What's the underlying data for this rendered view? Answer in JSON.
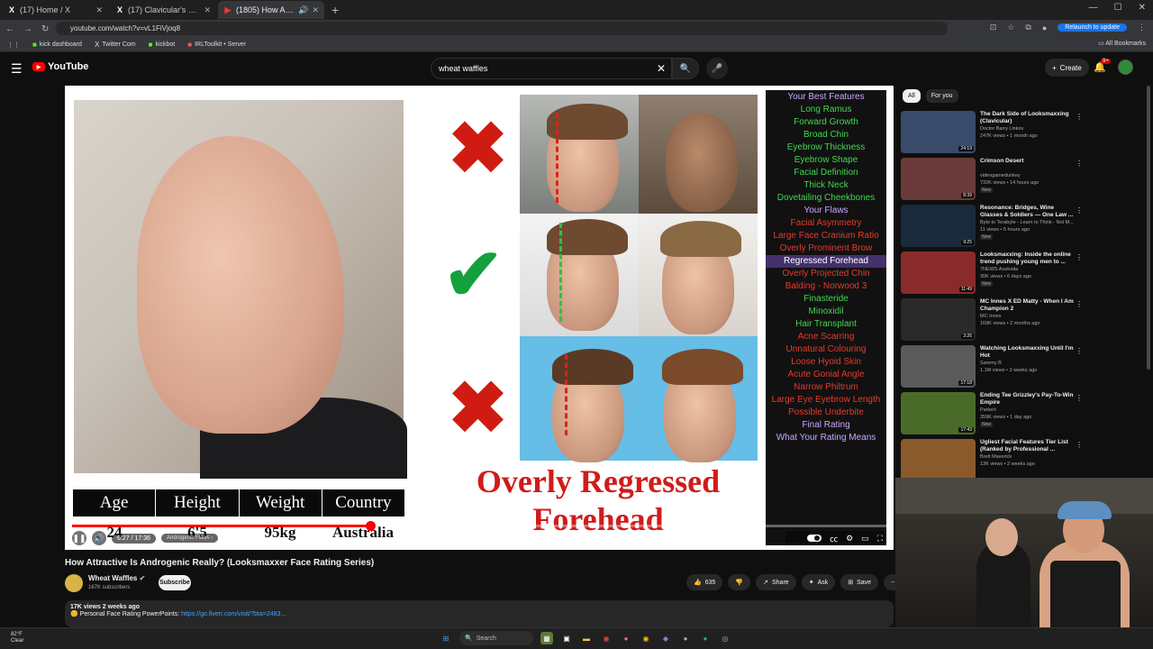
{
  "browser": {
    "tabs": [
      {
        "label": "(17) Home / X",
        "icon": "x-icon",
        "active": false
      },
      {
        "label": "(17) Clavicular's Clan Communi...",
        "icon": "x-icon",
        "active": false
      },
      {
        "label": "(1805) How Attractive Is An...",
        "icon": "youtube-icon",
        "active": true
      }
    ],
    "url": "youtube.com/watch?v=vL1FiVjoq8",
    "relaunch_label": "Relaunch to update",
    "bookmarks": [
      {
        "label": "kick dashboard",
        "icon": "kick-icon"
      },
      {
        "label": "Twitter Com",
        "icon": "x-icon"
      },
      {
        "label": "kickbot",
        "icon": "kick-icon"
      },
      {
        "label": "IRLToolkit • Server",
        "icon": "irl-icon"
      }
    ],
    "all_bookmarks": "All Bookmarks"
  },
  "header": {
    "logo": "YouTube",
    "search_value": "wheat waffles",
    "create_label": "Create",
    "notif_count": "9+"
  },
  "video": {
    "stats_headers": [
      "Age",
      "Height",
      "Weight",
      "Country"
    ],
    "stats_values": [
      "24",
      "6'5",
      "95kg",
      "Australia"
    ],
    "caption_line1": "Overly Regressed",
    "caption_line2": "Forehead",
    "features": [
      {
        "label": "Your Best Features",
        "kind": "head"
      },
      {
        "label": "Long Ramus",
        "kind": "good"
      },
      {
        "label": "Forward Growth",
        "kind": "good"
      },
      {
        "label": "Broad Chin",
        "kind": "good"
      },
      {
        "label": "Eyebrow Thickness",
        "kind": "good"
      },
      {
        "label": "Eyebrow Shape",
        "kind": "good"
      },
      {
        "label": "Facial Definition",
        "kind": "good"
      },
      {
        "label": "Thick Neck",
        "kind": "good"
      },
      {
        "label": "Dovetailing Cheekbones",
        "kind": "good"
      },
      {
        "label": "Your Flaws",
        "kind": "head"
      },
      {
        "label": "Facial Asymmetry",
        "kind": "bad"
      },
      {
        "label": "Large Face Cranium Ratio",
        "kind": "bad"
      },
      {
        "label": "Overly Prominent Brow",
        "kind": "bad"
      },
      {
        "label": "Regressed Forehead",
        "kind": "hl"
      },
      {
        "label": "Overly Projected Chin",
        "kind": "bad"
      },
      {
        "label": "Balding - Norwood 3",
        "kind": "bad"
      },
      {
        "label": "Finasteride",
        "kind": "good"
      },
      {
        "label": "Minoxidil",
        "kind": "good"
      },
      {
        "label": "Hair Transplant",
        "kind": "good"
      },
      {
        "label": "Acne Scarring",
        "kind": "bad"
      },
      {
        "label": "Unnatural Colouring",
        "kind": "bad"
      },
      {
        "label": "Loose Hyoid Skin",
        "kind": "bad"
      },
      {
        "label": "Acute Gonial Angle",
        "kind": "bad"
      },
      {
        "label": "Narrow Philtrum",
        "kind": "bad"
      },
      {
        "label": "Large Eye Eyebrow Length",
        "kind": "bad"
      },
      {
        "label": "Possible Underbite",
        "kind": "bad"
      },
      {
        "label": "Final Rating",
        "kind": "head"
      },
      {
        "label": "What Your Rating Means",
        "kind": "purple"
      }
    ],
    "time": "6:27 / 17:36",
    "chapter": "Androgenic Flaws",
    "progress": 0.366,
    "title": "How Attractive Is Androgenic Really? (Looksmaxxer Face Rating Series)"
  },
  "channel": {
    "name": "Wheat Waffles",
    "subs": "167K subscribers",
    "subscribe_label": "Subscribe"
  },
  "actions": {
    "likes": "635",
    "share": "Share",
    "ask": "Ask",
    "save": "Save"
  },
  "description": {
    "meta": "17K views  2 weeks ago",
    "line": "Personal Face Rating PowerPoints: ",
    "link": "https://go.fiverr.com/visit/?bta=2483..."
  },
  "sidebar": {
    "chips": [
      "All",
      "For you"
    ],
    "recs": [
      {
        "title": "The Dark Side of Looksmaxxing (Clavicular)",
        "channel": "Doctor Barry Linkov",
        "meta": "247K views • 1 month ago",
        "dur": "24:19",
        "new": "",
        "color": "#3a4a6a"
      },
      {
        "title": "Crimson Desert",
        "channel": "videogamedunkey",
        "meta": "732K views • 14 hours ago",
        "dur": "8:39",
        "new": "New",
        "color": "#6a3a3a"
      },
      {
        "title": "Resonance: Bridges, Wine Glasses & Soldiers — One Law ...",
        "channel": "Byte to Terabyte - Learn to Think - Not M...",
        "meta": "11 views • 5 hours ago",
        "dur": "9:25",
        "new": "New",
        "color": "#1b2a3a"
      },
      {
        "title": "Looksmaxxing: Inside the online trend pushing young men to ...",
        "channel": "7NEWS Australia",
        "meta": "30K views • 6 days ago",
        "dur": "11:49",
        "new": "New",
        "color": "#8a2b2b"
      },
      {
        "title": "MC Innes X ED Matty - When I Am Champion 2",
        "channel": "MC Innes",
        "meta": "169K views • 2 months ago",
        "dur": "3:26",
        "new": "",
        "color": "#2a2a2a"
      },
      {
        "title": "Watching Looksmaxxing Until I'm Hot",
        "channel": "Sammy B",
        "meta": "1.1M views • 3 weeks ago",
        "dur": "17:18",
        "new": "",
        "color": "#5a5a5a"
      },
      {
        "title": "Ending Tee Grizzley's Pay-To-Win Empire",
        "channel": "Parkert",
        "meta": "359K views • 1 day ago",
        "dur": "17:43",
        "new": "New",
        "color": "#4a6a2a"
      },
      {
        "title": "Ugliest Facial Features Tier List (Ranked by Professional ...",
        "channel": "Brett Maverick",
        "meta": "13K views • 2 weeks ago",
        "dur": "",
        "new": "",
        "color": "#8a5a2a"
      }
    ]
  },
  "taskbar": {
    "weather_temp": "82°F",
    "weather_desc": "Clear",
    "search_label": "Search"
  }
}
